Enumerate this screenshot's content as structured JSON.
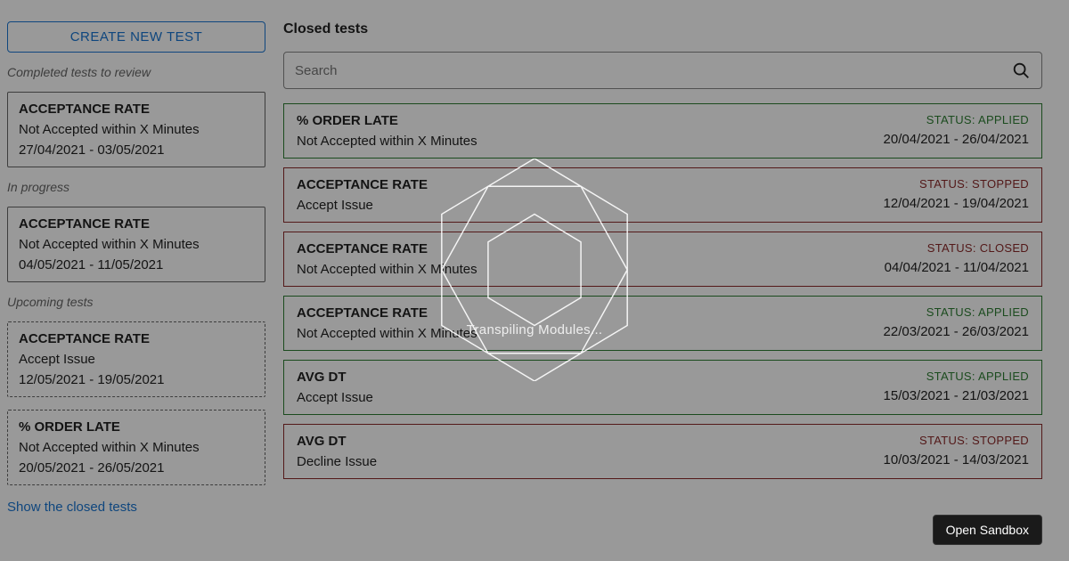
{
  "sidebar": {
    "create_label": "CREATE NEW TEST",
    "sections": {
      "completed": {
        "label": "Completed tests to review",
        "items": [
          {
            "title": "ACCEPTANCE RATE",
            "subtitle": "Not Accepted within X Minutes",
            "dates": "27/04/2021 - 03/05/2021"
          }
        ]
      },
      "in_progress": {
        "label": "In progress",
        "items": [
          {
            "title": "ACCEPTANCE RATE",
            "subtitle": "Not Accepted within X Minutes",
            "dates": "04/05/2021 - 11/05/2021"
          }
        ]
      },
      "upcoming": {
        "label": "Upcoming tests",
        "items": [
          {
            "title": "ACCEPTANCE RATE",
            "subtitle": "Accept Issue",
            "dates": "12/05/2021 - 19/05/2021"
          },
          {
            "title": "% ORDER LATE",
            "subtitle": "Not Accepted within X Minutes",
            "dates": "20/05/2021 - 26/05/2021"
          }
        ]
      }
    },
    "show_closed_label": "Show the closed tests"
  },
  "main": {
    "title": "Closed tests",
    "search_placeholder": "Search",
    "status_prefix": "STATUS:",
    "rows": [
      {
        "title": "% ORDER LATE",
        "subtitle": "Not Accepted within X Minutes",
        "dates": "20/04/2021 - 26/04/2021",
        "status": "APPLIED",
        "color": "green"
      },
      {
        "title": "ACCEPTANCE RATE",
        "subtitle": "Accept Issue",
        "dates": "12/04/2021 - 19/04/2021",
        "status": "STOPPED",
        "color": "red"
      },
      {
        "title": "ACCEPTANCE RATE",
        "subtitle": "Not Accepted within X Minutes",
        "dates": "04/04/2021 - 11/04/2021",
        "status": "CLOSED",
        "color": "red"
      },
      {
        "title": "ACCEPTANCE RATE",
        "subtitle": "Not Accepted within X Minutes",
        "dates": "22/03/2021 - 26/03/2021",
        "status": "APPLIED",
        "color": "green"
      },
      {
        "title": "AVG DT",
        "subtitle": "Accept Issue",
        "dates": "15/03/2021 - 21/03/2021",
        "status": "APPLIED",
        "color": "green"
      },
      {
        "title": "AVG DT",
        "subtitle": "Decline Issue",
        "dates": "10/03/2021 - 14/03/2021",
        "status": "STOPPED",
        "color": "red"
      }
    ]
  },
  "overlay": {
    "text": "Transpiling Modules..."
  },
  "footer": {
    "open_sandbox": "Open Sandbox"
  },
  "colors": {
    "accent": "#1976d2",
    "green": "#2e7d32",
    "red": "#8b2a2a"
  }
}
